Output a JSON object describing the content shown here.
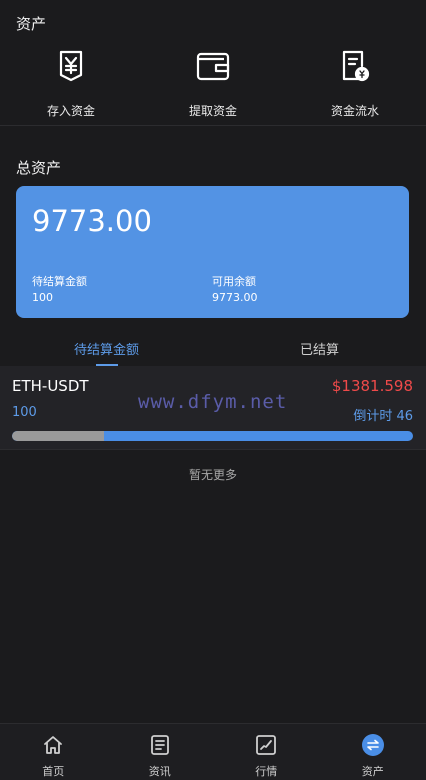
{
  "header": {
    "title": "资产"
  },
  "quick_actions": [
    {
      "label": "存入资金",
      "icon": "deposit-icon"
    },
    {
      "label": "提取资金",
      "icon": "wallet-icon"
    },
    {
      "label": "资金流水",
      "icon": "statement-icon"
    }
  ],
  "total_section": {
    "title": "总资产"
  },
  "card": {
    "total": "9773.00",
    "pending_label": "待结算金额",
    "pending_value": "100",
    "available_label": "可用余额",
    "available_value": "9773.00"
  },
  "tabs": [
    {
      "label": "待结算金额",
      "active": true
    },
    {
      "label": "已结算",
      "active": false
    }
  ],
  "orders": [
    {
      "pair": "ETH-USDT",
      "price": "$1381.598",
      "amount": "100",
      "countdown": "倒计时 46",
      "progress": 0.23
    }
  ],
  "watermark": "www.dfym.net",
  "empty_text": "暂无更多",
  "tabbar": [
    {
      "label": "首页",
      "icon": "home-icon"
    },
    {
      "label": "资讯",
      "icon": "news-icon"
    },
    {
      "label": "行情",
      "icon": "chart-icon"
    },
    {
      "label": "资产",
      "icon": "exchange-icon",
      "active": true
    }
  ],
  "colors": {
    "accent": "#5393e4",
    "price_red": "#ef4a4a",
    "background": "#1b1b1d"
  }
}
